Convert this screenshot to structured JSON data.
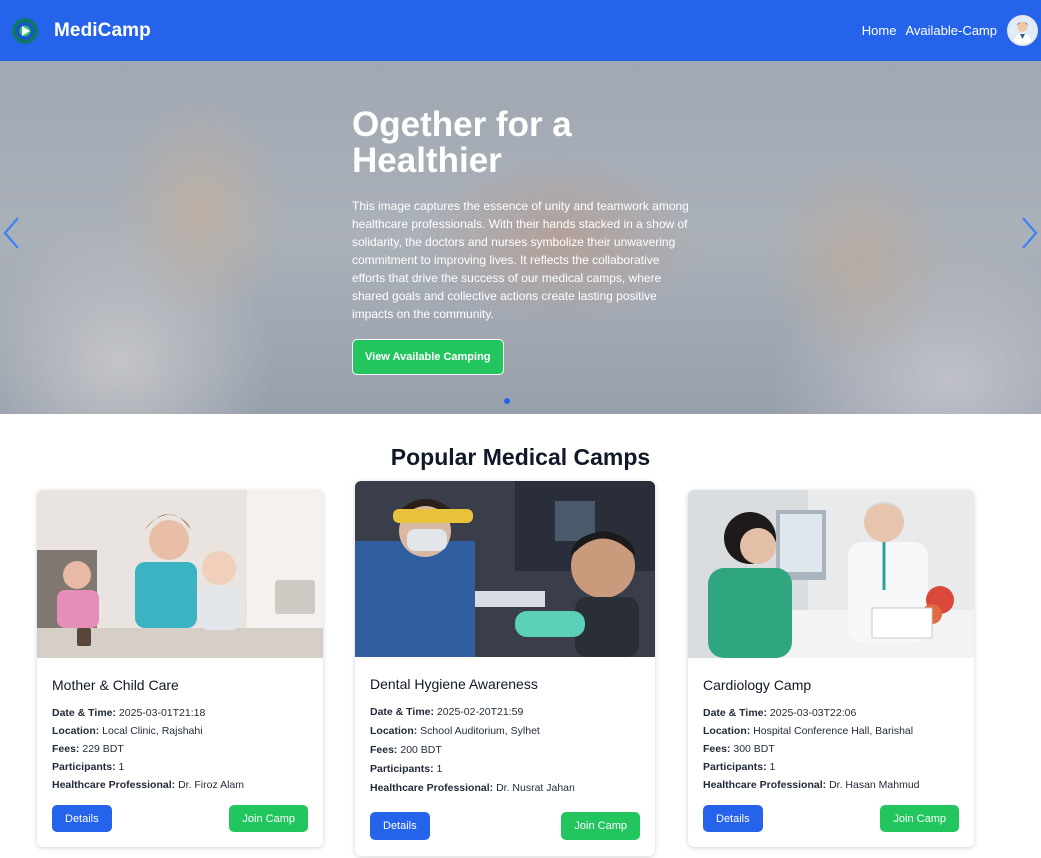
{
  "nav": {
    "brand": "MediCamp",
    "links": [
      "Home",
      "Available-Camp"
    ],
    "logo_icon": "medicamp-logo-icon",
    "avatar_icon": "user-avatar"
  },
  "hero": {
    "title": "Ogether for a Healthier",
    "text": "This image captures the essence of unity and teamwork among healthcare professionals. With their hands stacked in a show of solidarity, the doctors and nurses symbolize their unwavering commitment to improving lives. It reflects the collaborative efforts that drive the success of our medical camps, where shared goals and collective actions create lasting positive impacts on the community.",
    "button": "View Available Camping",
    "slide_count": 1,
    "active_slide": 1
  },
  "section": {
    "title": "Popular Medical Camps"
  },
  "labels": {
    "datetime": "Date & Time:",
    "location": "Location:",
    "fees": "Fees:",
    "participants": "Participants:",
    "professional": "Healthcare Professional:"
  },
  "camps": [
    {
      "name": "Mother & Child Care",
      "datetime": "2025-03-01T21:18",
      "location": "Local Clinic, Rajshahi",
      "fees": "229 BDT",
      "participants": "1",
      "professional": "Dr. Firoz Alam",
      "details_label": "Details",
      "join_label": "Join Camp"
    },
    {
      "name": "Dental Hygiene Awareness",
      "datetime": "2025-02-20T21:59",
      "location": "School Auditorium, Sylhet",
      "fees": "200 BDT",
      "participants": "1",
      "professional": "Dr. Nusrat Jahan",
      "details_label": "Details",
      "join_label": "Join Camp"
    },
    {
      "name": "Cardiology Camp",
      "datetime": "2025-03-03T22:06",
      "location": "Hospital Conference Hall, Barishal",
      "fees": "300 BDT",
      "participants": "1",
      "professional": "Dr. Hasan Mahmud",
      "details_label": "Details",
      "join_label": "Join Camp"
    }
  ],
  "colors": {
    "primary": "#2563eb",
    "success": "#22c55e"
  }
}
